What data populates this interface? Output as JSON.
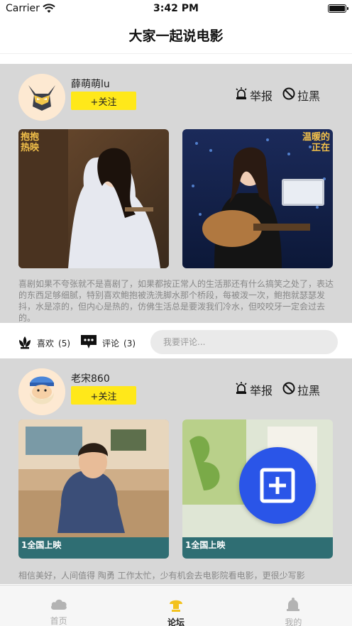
{
  "status_bar": {
    "carrier": "Carrier",
    "time": "3:42 PM"
  },
  "nav": {
    "title": "大家一起说电影"
  },
  "posts": [
    {
      "username": "薛萌萌lu",
      "follow_label": "+关注",
      "report_label": "举报",
      "block_label": "拉黑",
      "avatar_icon": "wolverine-mask-icon",
      "images": [
        {
          "label": "抱抱 热映"
        },
        {
          "label": "温暖的 正在"
        }
      ],
      "caption": "喜剧如果不夸张就不是喜剧了，如果都按正常人的生活那还有什么搞笑之处了，表达的东西足够细腻，特别喜欢鲍抱被洗洗脚水那个桥段，每被泼一次，鲍抱就瑟瑟发抖，水是凉的，但内心是热的，仿佛生活总是要泼我们冷水，但咬咬牙一定会过去的。",
      "like_label": "喜欢",
      "like_count": "(5)",
      "comment_label": "评论",
      "comment_count": "(3)",
      "comment_placeholder": "我要评论..."
    },
    {
      "username": "老宋860",
      "follow_label": "+关注",
      "report_label": "举报",
      "block_label": "拉黑",
      "avatar_icon": "bearded-man-avatar-icon",
      "images": [
        {
          "label": "1全国上映"
        },
        {
          "label": "1全国上映"
        }
      ],
      "caption": "相信美好，人间值得 陶勇 工作太忙，少有机会去电影院看电影，更很少写影"
    }
  ],
  "fab": {
    "icon": "add-square-icon"
  },
  "tabs": [
    {
      "label": "首页",
      "icon": "cloud-icon",
      "active": false
    },
    {
      "label": "论坛",
      "icon": "lamp-icon",
      "active": true
    },
    {
      "label": "我的",
      "icon": "bell-icon",
      "active": false
    }
  ],
  "colors": {
    "accent_yellow": "#ffe81a",
    "fab_blue": "#2a55e8",
    "card_gray": "#d7d7d7"
  }
}
